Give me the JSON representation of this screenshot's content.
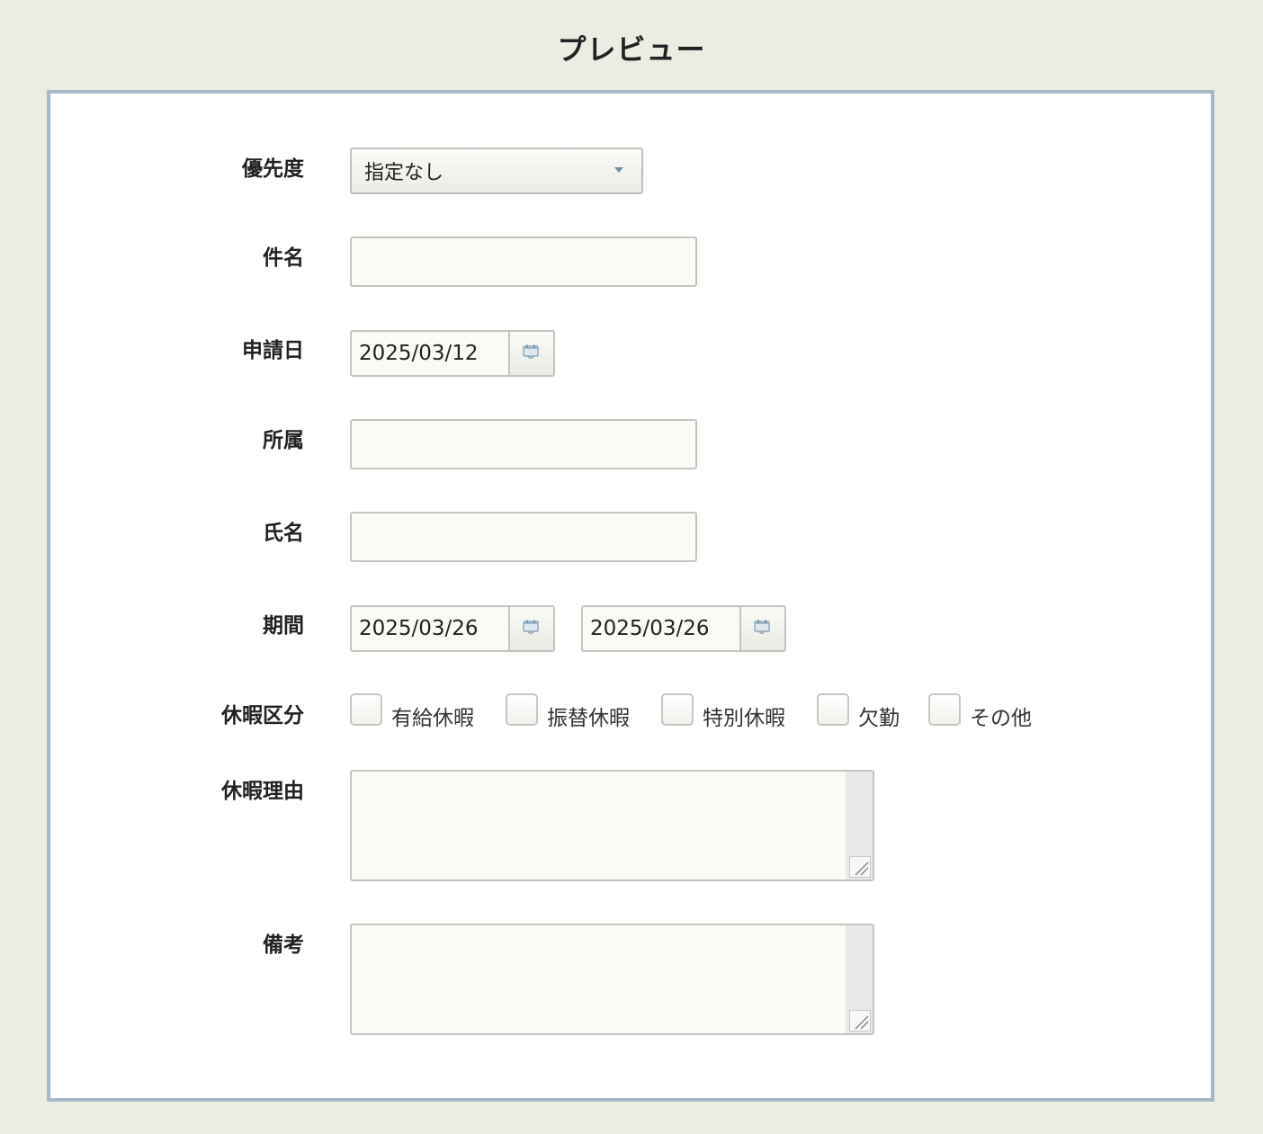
{
  "page": {
    "title": "プレビュー"
  },
  "form": {
    "priority": {
      "label": "優先度",
      "selected": "指定なし"
    },
    "subject": {
      "label": "件名",
      "value": ""
    },
    "application_date": {
      "label": "申請日",
      "value": "2025/03/12"
    },
    "department": {
      "label": "所属",
      "value": ""
    },
    "name": {
      "label": "氏名",
      "value": ""
    },
    "period": {
      "label": "期間",
      "start": "2025/03/26",
      "end": "2025/03/26"
    },
    "leave_type": {
      "label": "休暇区分",
      "options": [
        {
          "label": "有給休暇",
          "checked": false
        },
        {
          "label": "振替休暇",
          "checked": false
        },
        {
          "label": "特別休暇",
          "checked": false
        },
        {
          "label": "欠勤",
          "checked": false
        },
        {
          "label": "その他",
          "checked": false
        }
      ]
    },
    "leave_reason": {
      "label": "休暇理由",
      "value": ""
    },
    "remarks": {
      "label": "備考",
      "value": ""
    }
  },
  "icons": {
    "calendar": "calendar-icon",
    "dropdown": "chevron-down-icon",
    "resize": "resize-grip-icon"
  },
  "colors": {
    "page_background": "#edece3",
    "panel_border": "#a7b9c9",
    "input_background": "#fbfaf5",
    "accent": "#6c8fa9"
  }
}
